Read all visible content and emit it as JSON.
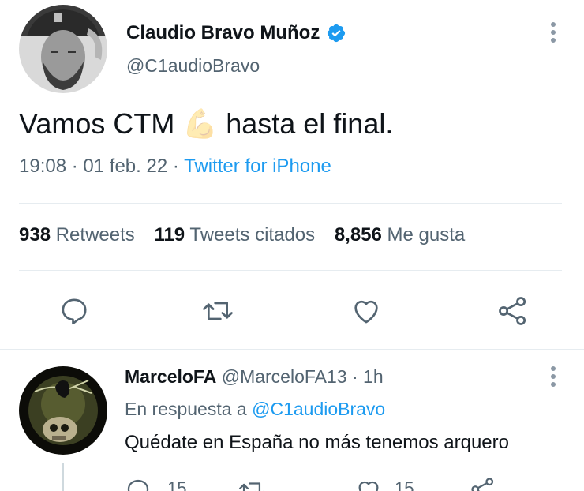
{
  "tweet": {
    "author_name": "Claudio Bravo Muñoz",
    "handle": "@C1audioBravo",
    "text_before": "Vamos CTM",
    "emoji": "💪",
    "text_after": "hasta el final.",
    "time": "19:08",
    "sep": "·",
    "date": "01 feb. 22",
    "source": "Twitter for iPhone",
    "stats": {
      "retweets_count": "938",
      "retweets_label": "Retweets",
      "quotes_count": "119",
      "quotes_label": "Tweets citados",
      "likes_count": "8,856",
      "likes_label": "Me gusta"
    }
  },
  "reply": {
    "author_name": "MarceloFA",
    "handle": "@MarceloFA13",
    "sep": "·",
    "time_ago": "1h",
    "replying_prefix": "En respuesta a",
    "replying_to": "@C1audioBravo",
    "text": "Quédate en España no más tenemos arquero",
    "reply_count": "15",
    "like_count": "15"
  },
  "colors": {
    "accent": "#1d9bf0",
    "muted": "#536471",
    "verified": "#1d9bf0"
  }
}
